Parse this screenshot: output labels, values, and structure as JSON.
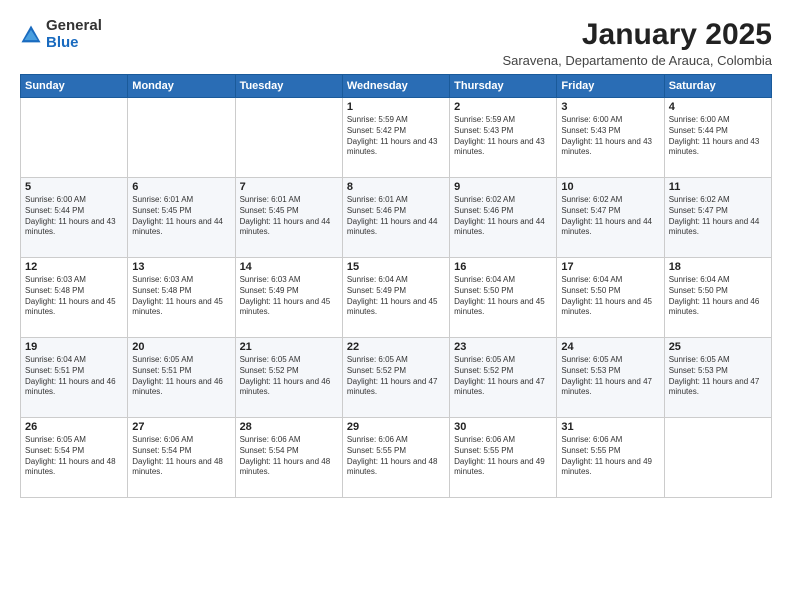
{
  "logo": {
    "general": "General",
    "blue": "Blue"
  },
  "title": "January 2025",
  "location": "Saravena, Departamento de Arauca, Colombia",
  "weekdays": [
    "Sunday",
    "Monday",
    "Tuesday",
    "Wednesday",
    "Thursday",
    "Friday",
    "Saturday"
  ],
  "weeks": [
    [
      {
        "day": "",
        "sunrise": "",
        "sunset": "",
        "daylight": ""
      },
      {
        "day": "",
        "sunrise": "",
        "sunset": "",
        "daylight": ""
      },
      {
        "day": "",
        "sunrise": "",
        "sunset": "",
        "daylight": ""
      },
      {
        "day": "1",
        "sunrise": "Sunrise: 5:59 AM",
        "sunset": "Sunset: 5:42 PM",
        "daylight": "Daylight: 11 hours and 43 minutes."
      },
      {
        "day": "2",
        "sunrise": "Sunrise: 5:59 AM",
        "sunset": "Sunset: 5:43 PM",
        "daylight": "Daylight: 11 hours and 43 minutes."
      },
      {
        "day": "3",
        "sunrise": "Sunrise: 6:00 AM",
        "sunset": "Sunset: 5:43 PM",
        "daylight": "Daylight: 11 hours and 43 minutes."
      },
      {
        "day": "4",
        "sunrise": "Sunrise: 6:00 AM",
        "sunset": "Sunset: 5:44 PM",
        "daylight": "Daylight: 11 hours and 43 minutes."
      }
    ],
    [
      {
        "day": "5",
        "sunrise": "Sunrise: 6:00 AM",
        "sunset": "Sunset: 5:44 PM",
        "daylight": "Daylight: 11 hours and 43 minutes."
      },
      {
        "day": "6",
        "sunrise": "Sunrise: 6:01 AM",
        "sunset": "Sunset: 5:45 PM",
        "daylight": "Daylight: 11 hours and 44 minutes."
      },
      {
        "day": "7",
        "sunrise": "Sunrise: 6:01 AM",
        "sunset": "Sunset: 5:45 PM",
        "daylight": "Daylight: 11 hours and 44 minutes."
      },
      {
        "day": "8",
        "sunrise": "Sunrise: 6:01 AM",
        "sunset": "Sunset: 5:46 PM",
        "daylight": "Daylight: 11 hours and 44 minutes."
      },
      {
        "day": "9",
        "sunrise": "Sunrise: 6:02 AM",
        "sunset": "Sunset: 5:46 PM",
        "daylight": "Daylight: 11 hours and 44 minutes."
      },
      {
        "day": "10",
        "sunrise": "Sunrise: 6:02 AM",
        "sunset": "Sunset: 5:47 PM",
        "daylight": "Daylight: 11 hours and 44 minutes."
      },
      {
        "day": "11",
        "sunrise": "Sunrise: 6:02 AM",
        "sunset": "Sunset: 5:47 PM",
        "daylight": "Daylight: 11 hours and 44 minutes."
      }
    ],
    [
      {
        "day": "12",
        "sunrise": "Sunrise: 6:03 AM",
        "sunset": "Sunset: 5:48 PM",
        "daylight": "Daylight: 11 hours and 45 minutes."
      },
      {
        "day": "13",
        "sunrise": "Sunrise: 6:03 AM",
        "sunset": "Sunset: 5:48 PM",
        "daylight": "Daylight: 11 hours and 45 minutes."
      },
      {
        "day": "14",
        "sunrise": "Sunrise: 6:03 AM",
        "sunset": "Sunset: 5:49 PM",
        "daylight": "Daylight: 11 hours and 45 minutes."
      },
      {
        "day": "15",
        "sunrise": "Sunrise: 6:04 AM",
        "sunset": "Sunset: 5:49 PM",
        "daylight": "Daylight: 11 hours and 45 minutes."
      },
      {
        "day": "16",
        "sunrise": "Sunrise: 6:04 AM",
        "sunset": "Sunset: 5:50 PM",
        "daylight": "Daylight: 11 hours and 45 minutes."
      },
      {
        "day": "17",
        "sunrise": "Sunrise: 6:04 AM",
        "sunset": "Sunset: 5:50 PM",
        "daylight": "Daylight: 11 hours and 45 minutes."
      },
      {
        "day": "18",
        "sunrise": "Sunrise: 6:04 AM",
        "sunset": "Sunset: 5:50 PM",
        "daylight": "Daylight: 11 hours and 46 minutes."
      }
    ],
    [
      {
        "day": "19",
        "sunrise": "Sunrise: 6:04 AM",
        "sunset": "Sunset: 5:51 PM",
        "daylight": "Daylight: 11 hours and 46 minutes."
      },
      {
        "day": "20",
        "sunrise": "Sunrise: 6:05 AM",
        "sunset": "Sunset: 5:51 PM",
        "daylight": "Daylight: 11 hours and 46 minutes."
      },
      {
        "day": "21",
        "sunrise": "Sunrise: 6:05 AM",
        "sunset": "Sunset: 5:52 PM",
        "daylight": "Daylight: 11 hours and 46 minutes."
      },
      {
        "day": "22",
        "sunrise": "Sunrise: 6:05 AM",
        "sunset": "Sunset: 5:52 PM",
        "daylight": "Daylight: 11 hours and 47 minutes."
      },
      {
        "day": "23",
        "sunrise": "Sunrise: 6:05 AM",
        "sunset": "Sunset: 5:52 PM",
        "daylight": "Daylight: 11 hours and 47 minutes."
      },
      {
        "day": "24",
        "sunrise": "Sunrise: 6:05 AM",
        "sunset": "Sunset: 5:53 PM",
        "daylight": "Daylight: 11 hours and 47 minutes."
      },
      {
        "day": "25",
        "sunrise": "Sunrise: 6:05 AM",
        "sunset": "Sunset: 5:53 PM",
        "daylight": "Daylight: 11 hours and 47 minutes."
      }
    ],
    [
      {
        "day": "26",
        "sunrise": "Sunrise: 6:05 AM",
        "sunset": "Sunset: 5:54 PM",
        "daylight": "Daylight: 11 hours and 48 minutes."
      },
      {
        "day": "27",
        "sunrise": "Sunrise: 6:06 AM",
        "sunset": "Sunset: 5:54 PM",
        "daylight": "Daylight: 11 hours and 48 minutes."
      },
      {
        "day": "28",
        "sunrise": "Sunrise: 6:06 AM",
        "sunset": "Sunset: 5:54 PM",
        "daylight": "Daylight: 11 hours and 48 minutes."
      },
      {
        "day": "29",
        "sunrise": "Sunrise: 6:06 AM",
        "sunset": "Sunset: 5:55 PM",
        "daylight": "Daylight: 11 hours and 48 minutes."
      },
      {
        "day": "30",
        "sunrise": "Sunrise: 6:06 AM",
        "sunset": "Sunset: 5:55 PM",
        "daylight": "Daylight: 11 hours and 49 minutes."
      },
      {
        "day": "31",
        "sunrise": "Sunrise: 6:06 AM",
        "sunset": "Sunset: 5:55 PM",
        "daylight": "Daylight: 11 hours and 49 minutes."
      },
      {
        "day": "",
        "sunrise": "",
        "sunset": "",
        "daylight": ""
      }
    ]
  ]
}
